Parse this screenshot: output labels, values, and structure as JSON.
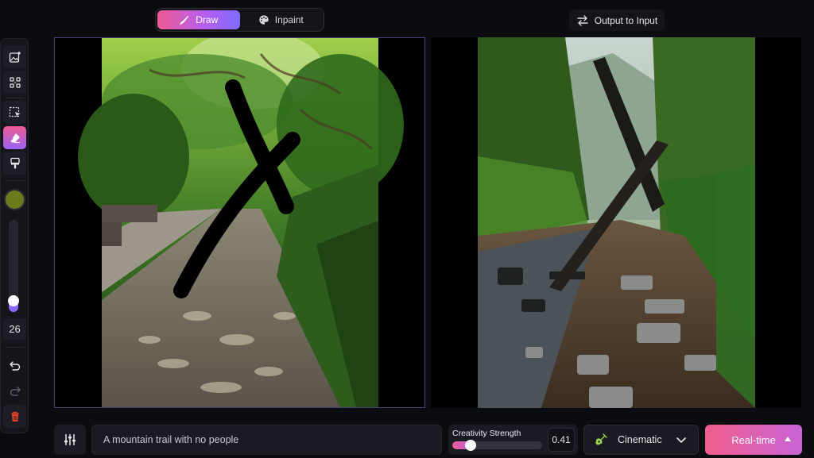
{
  "mode_toggle": {
    "draw_label": "Draw",
    "inpaint_label": "Inpaint",
    "active": "draw"
  },
  "output_to_input": {
    "label": "Output to Input"
  },
  "toolbar": {
    "tools": [
      {
        "name": "add-image",
        "icon": "image-plus-icon"
      },
      {
        "name": "scan",
        "icon": "scan-icon"
      },
      {
        "name": "select",
        "icon": "select-cursor-icon"
      },
      {
        "name": "eraser",
        "icon": "eraser-icon",
        "active": true
      },
      {
        "name": "brush",
        "icon": "paint-brush-icon"
      }
    ],
    "brush_color": "#6b7a1c",
    "brush_size": "26",
    "brush_size_level": 0.06,
    "undo_icon": "undo-icon",
    "redo_icon": "redo-icon",
    "delete_icon": "trash-icon"
  },
  "prompt": {
    "value": "A mountain trail with no people",
    "settings_icon": "sliders-icon"
  },
  "creativity": {
    "label": "Creativity Strength",
    "value": "0.41",
    "level": 0.16
  },
  "style": {
    "label": "Cinematic",
    "icon": "guitar-icon"
  },
  "generate": {
    "label": "Real-time"
  },
  "colors": {
    "accent_gradient_start": "#ee5b93",
    "accent_gradient_end": "#7e6cff",
    "background": "#0b0c10",
    "delete": "#e8412a"
  }
}
